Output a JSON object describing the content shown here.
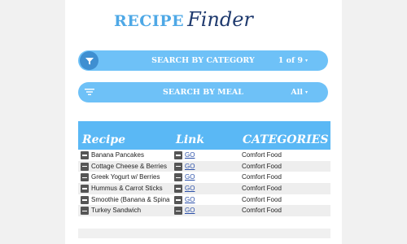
{
  "logo": {
    "part1": "RECIPE",
    "part2": "Finder"
  },
  "category_filter": {
    "label": "SEARCH BY CATEGORY",
    "value": "1 of 9",
    "icon": "funnel-icon",
    "caret": "▾"
  },
  "meal_filter": {
    "label": "SEARCH BY MEAL",
    "value": "All",
    "icon": "filter-lines-icon",
    "caret": "▾"
  },
  "table": {
    "headers": {
      "recipe": "Recipe",
      "link": "Link",
      "categories": "CATEGORIES"
    },
    "rows": [
      {
        "recipe": "Banana Pancakes",
        "link": "GO",
        "category": "Comfort Food"
      },
      {
        "recipe": "Cottage Cheese & Berries",
        "link": "GO",
        "category": "Comfort Food"
      },
      {
        "recipe": "Greek Yogurt w/ Berries",
        "link": "GO",
        "category": "Comfort Food"
      },
      {
        "recipe": "Hummus & Carrot Sticks",
        "link": "GO",
        "category": "Comfort Food"
      },
      {
        "recipe": "Smoothie (Banana & Spina",
        "link": "GO",
        "category": "Comfort Food"
      },
      {
        "recipe": "Turkey Sandwich",
        "link": "GO",
        "category": "Comfort Food"
      }
    ]
  },
  "colors": {
    "accent": "#6ec1f7",
    "header": "#5ab8f5",
    "icon_circle": "#3f8fd1",
    "logo_blue": "#4ea8e6",
    "logo_navy": "#1f3a6e"
  }
}
